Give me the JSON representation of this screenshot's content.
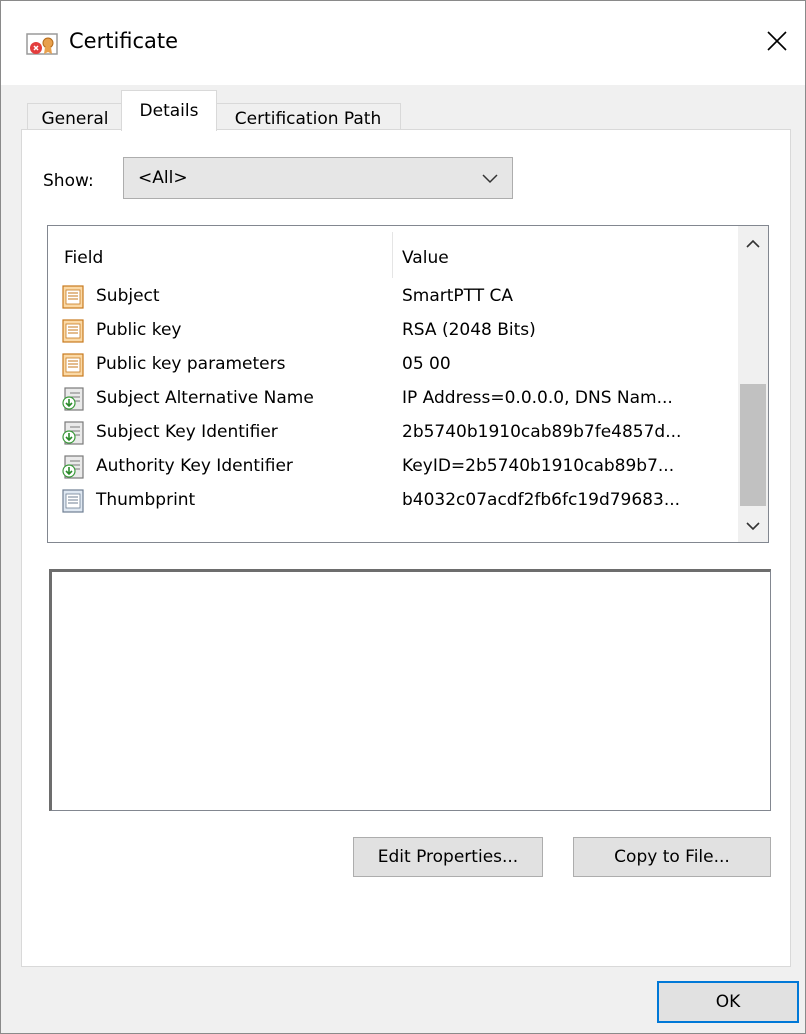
{
  "window": {
    "title": "Certificate"
  },
  "tabs": [
    {
      "label": "General",
      "active": false
    },
    {
      "label": "Details",
      "active": true
    },
    {
      "label": "Certification Path",
      "active": false
    }
  ],
  "show": {
    "label": "Show:",
    "value": "<All>"
  },
  "list": {
    "columns": [
      "Field",
      "Value"
    ],
    "rows": [
      {
        "field": "Subject",
        "value": "SmartPTT CA",
        "icon": "cert-field-icon"
      },
      {
        "field": "Public key",
        "value": "RSA (2048 Bits)",
        "icon": "cert-field-icon"
      },
      {
        "field": "Public key parameters",
        "value": "05 00",
        "icon": "cert-field-icon"
      },
      {
        "field": "Subject Alternative Name",
        "value": "IP Address=0.0.0.0, DNS Nam...",
        "icon": "extension-icon"
      },
      {
        "field": "Subject Key Identifier",
        "value": "2b5740b1910cab89b7fe4857d...",
        "icon": "extension-icon"
      },
      {
        "field": "Authority Key Identifier",
        "value": "KeyID=2b5740b1910cab89b7...",
        "icon": "extension-icon"
      },
      {
        "field": "Thumbprint",
        "value": "b4032c07acdf2fb6fc19d79683...",
        "icon": "property-icon"
      }
    ]
  },
  "buttons": {
    "edit_properties": "Edit Properties...",
    "copy_to_file": "Copy to File...",
    "ok": "OK"
  },
  "colors": {
    "accent": "#0078d7",
    "field_icon": "#e8a04c"
  }
}
